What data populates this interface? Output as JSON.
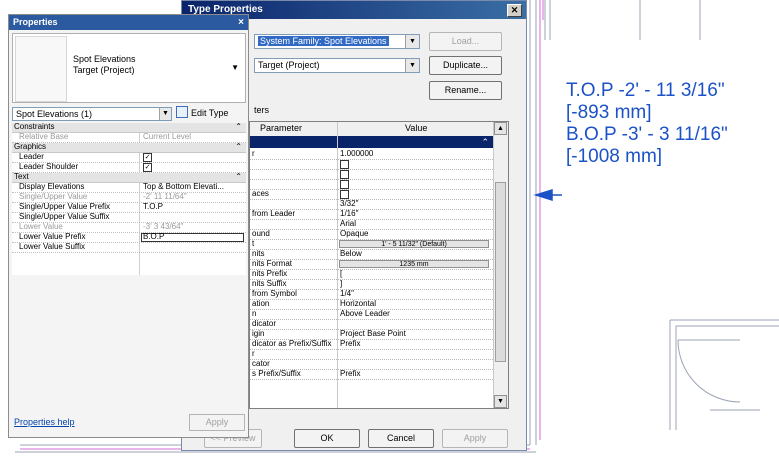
{
  "annotation": {
    "lines": [
      "T.O.P -2' - 11 3/16\"",
      "[-893 mm]",
      "B.O.P -3' - 3 11/16\"",
      "[-1008 mm]"
    ],
    "color": "#1c52c7"
  },
  "type_dialog": {
    "title": "Type Properties",
    "family_value": "System Family: Spot Elevations",
    "type_value": "Target (Project)",
    "load_label": "Load...",
    "duplicate_label": "Duplicate...",
    "rename_label": "Rename...",
    "parameters_heading": "ters",
    "col_parameter": "Parameter",
    "col_value": "Value",
    "rows": [
      {
        "p": "r",
        "v": "1.000000"
      },
      {
        "p": "",
        "v": ""
      },
      {
        "p": "",
        "v": ""
      },
      {
        "p": "",
        "v": ""
      },
      {
        "p": "aces",
        "v": ""
      },
      {
        "p": "",
        "v": "3/32\""
      },
      {
        "p": "from Leader",
        "v": "1/16\""
      },
      {
        "p": "",
        "v": "Arial"
      },
      {
        "p": "ound",
        "v": "Opaque"
      },
      {
        "p": "t",
        "v": "1' - 5 11/32\" (Default)"
      },
      {
        "p": "nits",
        "v": "Below"
      },
      {
        "p": "nits Format",
        "v": "1235 mm"
      },
      {
        "p": "nits Prefix",
        "v": "["
      },
      {
        "p": "nits Suffix",
        "v": "]"
      },
      {
        "p": "from Symbol",
        "v": "1/4\""
      },
      {
        "p": "ation",
        "v": "Horizontal"
      },
      {
        "p": "n",
        "v": "Above Leader"
      },
      {
        "p": "dicator",
        "v": ""
      },
      {
        "p": "igin",
        "v": "Project Base Point"
      },
      {
        "p": "dicator as Prefix/Suffix",
        "v": "Prefix"
      },
      {
        "p": "r",
        "v": ""
      },
      {
        "p": "cator",
        "v": ""
      },
      {
        "p": "s Prefix/Suffix",
        "v": "Prefix"
      }
    ],
    "preview_label": "<< Preview",
    "ok_label": "OK",
    "cancel_label": "Cancel",
    "apply_label": "Apply"
  },
  "properties": {
    "title": "Properties",
    "close": "×",
    "type_line1": "Spot Elevations",
    "type_line2": "Target (Project)",
    "selector": "Spot Elevations (1)",
    "edit_type": "Edit Type",
    "categories": {
      "constraints": "Constraints",
      "graphics": "Graphics",
      "text": "Text"
    },
    "rows": {
      "relative_base": {
        "p": "Relative Base",
        "v": "Current Level"
      },
      "leader": {
        "p": "Leader",
        "v": "☑"
      },
      "leader_shoulder": {
        "p": "Leader Shoulder",
        "v": "☑"
      },
      "display_elevations": {
        "p": "Display Elevations",
        "v": "Top & Bottom Elevati..."
      },
      "single_upper_value": {
        "p": "Single/Upper Value",
        "v": "-2'  11 11/64\""
      },
      "single_upper_prefix": {
        "p": "Single/Upper Value Prefix",
        "v": "T.O.P"
      },
      "single_upper_suffix": {
        "p": "Single/Upper Value Suffix",
        "v": ""
      },
      "lower_value": {
        "p": "Lower Value",
        "v": "-3'  3 43/64\""
      },
      "lower_prefix": {
        "p": "Lower Value Prefix",
        "v": "B.O.P"
      },
      "lower_suffix": {
        "p": "Lower Value Suffix",
        "v": ""
      }
    },
    "help_link": "Properties help",
    "apply": "Apply"
  }
}
